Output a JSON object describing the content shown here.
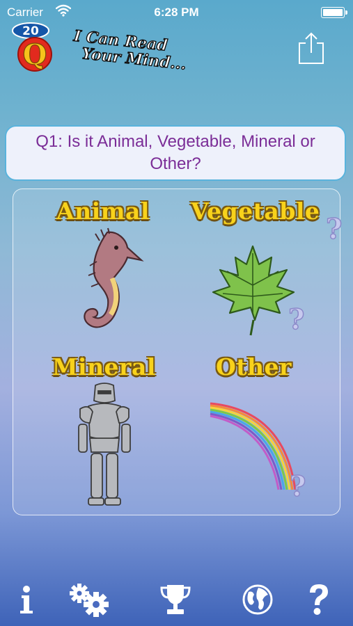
{
  "status_bar": {
    "carrier": "Carrier",
    "time": "6:28 PM"
  },
  "header": {
    "logo_badge": "20",
    "logo_letter": "Q",
    "tagline_line1": "I Can Read",
    "tagline_line2": "Your Mind..."
  },
  "question": {
    "text": "Q1:  Is it Animal, Vegetable, Mineral or Other?"
  },
  "categories": [
    {
      "label": "Animal",
      "icon": "seahorse-icon"
    },
    {
      "label": "Vegetable",
      "icon": "maple-leaf-icon"
    },
    {
      "label": "Mineral",
      "icon": "knight-armor-icon"
    },
    {
      "label": "Other",
      "icon": "rainbow-icon"
    }
  ],
  "hint_mark": "?",
  "tab_bar": [
    "info-icon",
    "settings-gears-icon",
    "trophy-icon",
    "globe-icon",
    "help-icon"
  ],
  "colors": {
    "question_text": "#7b2d97",
    "label_fill": "#f8d21b",
    "label_outline": "#7a5a12",
    "question_border": "#59b3dc"
  }
}
